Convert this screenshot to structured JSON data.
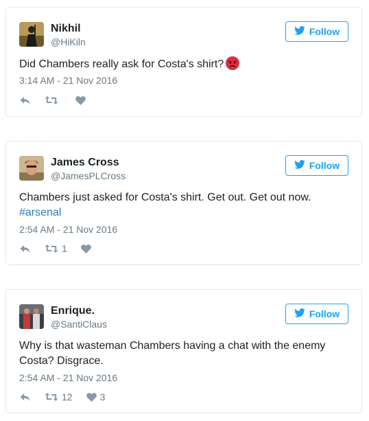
{
  "colors": {
    "accent": "#1da1f2",
    "hashtag": "#2b7bb9",
    "muted": "#697882",
    "border": "#e1e8ed"
  },
  "tweets": [
    {
      "name": "Nikhil",
      "handle": "@HiKiln",
      "follow_label": "Follow",
      "text": "Did Chambers really ask for Costa's shirt?",
      "emoji": "angry-face-icon",
      "time": "3:14 AM - 21 Nov 2016",
      "retweets": "",
      "likes": ""
    },
    {
      "name": "James Cross",
      "handle": "@JamesPLCross",
      "follow_label": "Follow",
      "text": "Chambers just asked for Costa's shirt. Get out. Get out now.",
      "hashtag": "#arsenal",
      "time": "2:54 AM - 21 Nov 2016",
      "retweets": "1",
      "likes": ""
    },
    {
      "name": "Enrique.",
      "handle": "@SantiClaus",
      "follow_label": "Follow",
      "text": "Why is that wasteman Chambers having a chat with the enemy Costa? Disgrace.",
      "time": "2:54 AM - 21 Nov 2016",
      "retweets": "12",
      "likes": "3"
    }
  ]
}
